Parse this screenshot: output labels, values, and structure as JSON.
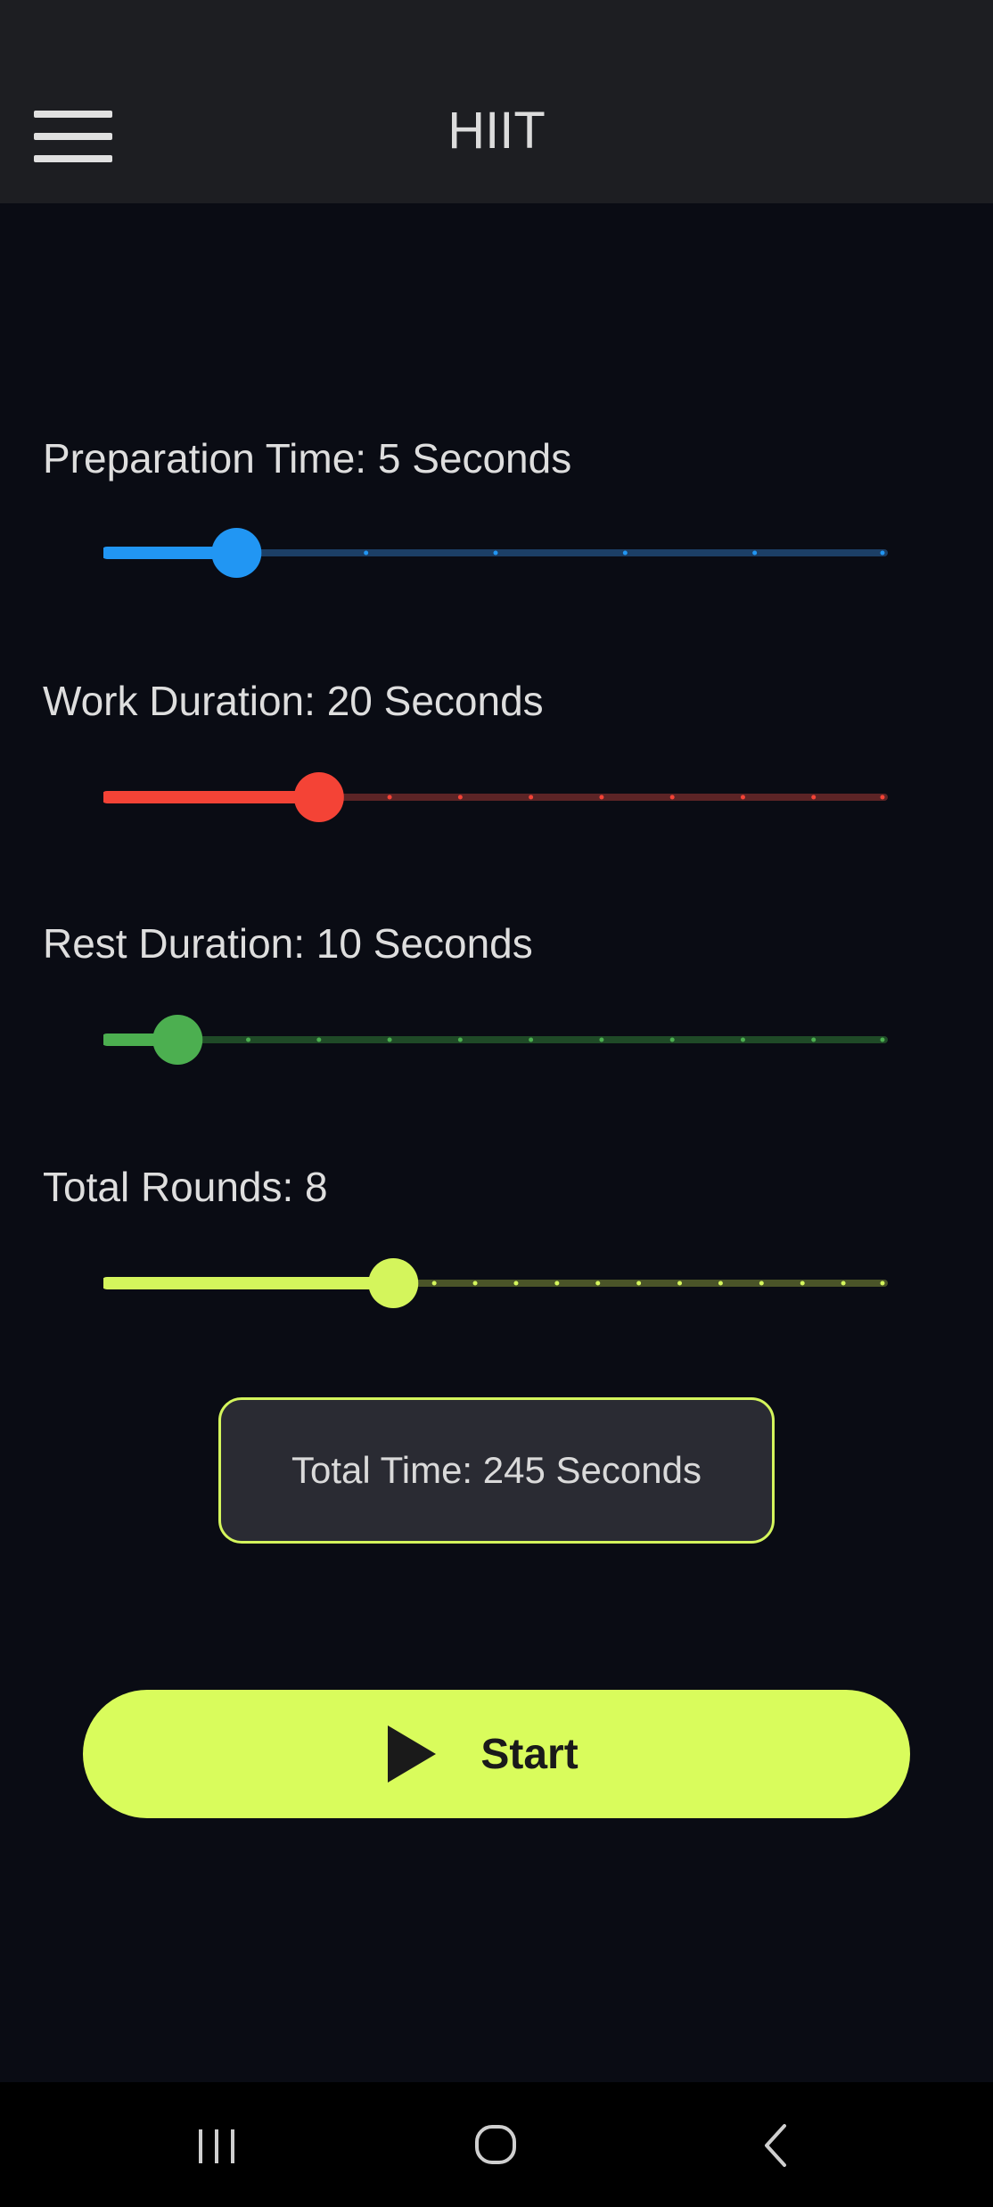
{
  "app_bar": {
    "title": "HIIT",
    "menu_icon": "hamburger-menu-icon"
  },
  "settings": [
    {
      "id": "preparation",
      "label": "Preparation Time: 5 Seconds",
      "value": 5,
      "min": 0,
      "max": 30,
      "divisions": 6,
      "color": "#2196f3",
      "track_color": "#1c3f66"
    },
    {
      "id": "work",
      "label": "Work Duration: 20 Seconds",
      "value": 20,
      "min": 5,
      "max": 60,
      "divisions": 11,
      "color": "#f44336",
      "track_color": "#5c2426"
    },
    {
      "id": "rest",
      "label": "Rest Duration: 10 Seconds",
      "value": 10,
      "min": 5,
      "max": 60,
      "divisions": 11,
      "color": "#4caf50",
      "track_color": "#1f4a27"
    },
    {
      "id": "rounds",
      "label": "Total Rounds: 8",
      "value": 8,
      "min": 1,
      "max": 20,
      "divisions": 19,
      "color": "#d4f55c",
      "track_color": "#4a5428"
    }
  ],
  "summary": {
    "text": "Total Time: 245 Seconds",
    "border_color": "#d4f55c"
  },
  "start_button": {
    "label": "Start",
    "icon": "play-icon",
    "color": "#d9fc5c"
  },
  "nav": {
    "recents_icon": "recent-apps-icon",
    "home_icon": "home-icon",
    "back_icon": "back-icon"
  }
}
